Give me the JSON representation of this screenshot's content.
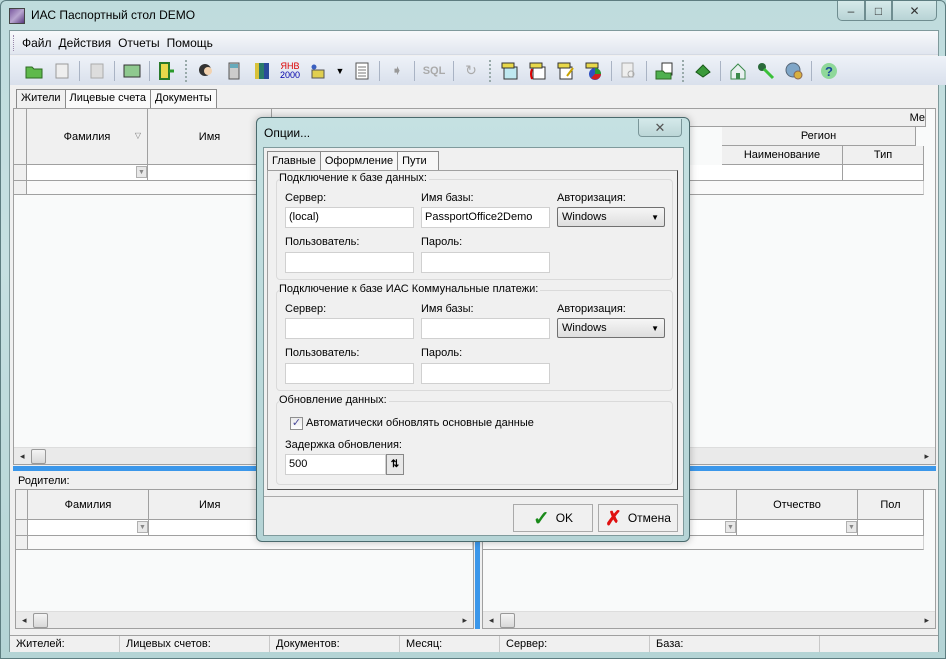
{
  "window": {
    "title": "ИАС Паспортный стол DEMO",
    "controls": {
      "minimize": "–",
      "maximize": "□",
      "close": "✕"
    }
  },
  "menu": [
    "Файл",
    "Действия",
    "Отчеты",
    "Помощь"
  ],
  "toolbar": {
    "icons": [
      "open-folder-icon",
      "document-icon",
      "calculator-icon",
      "image-icon",
      "exit-door-icon",
      "users-icon",
      "phone-icon",
      "books-icon",
      "calendar-icon",
      "package-icon",
      "list-icon",
      "import-icon",
      "sql-icon",
      "redo-icon",
      "print-notes-icon",
      "print-code-icon",
      "print-edit-icon",
      "print-chart-icon",
      "preview-icon",
      "open-file-icon",
      "money-icon",
      "home-icon",
      "key-icon",
      "globe-settings-icon",
      "help-icon"
    ],
    "calendar_top": "ЯНВ",
    "calendar_bottom": "2000",
    "sql_label": "SQL"
  },
  "tabs": [
    "Жители",
    "Лицевые счета",
    "Документы"
  ],
  "residents_grid": {
    "columns": [
      "Фамилия",
      "Имя"
    ],
    "right_group_header": "Ме",
    "region_group": "Регион",
    "region_columns": [
      "Наименование",
      "Тип"
    ]
  },
  "parents": {
    "label": "Родители:",
    "left_columns": [
      "Фамилия",
      "Имя"
    ],
    "right_columns": [
      "Отчество",
      "Пол"
    ]
  },
  "statusbar": [
    "Жителей:",
    "Лицевых счетов:",
    "Документов:",
    "Месяц:",
    "Сервер:",
    "База:"
  ],
  "dialog": {
    "title": "Опции...",
    "close": "✕",
    "tabs": [
      "Главные",
      "Оформление",
      "Пути"
    ],
    "db_group": {
      "label": "Подключение к базе данных:",
      "server_label": "Сервер:",
      "server_value": "(local)",
      "dbname_label": "Имя базы:",
      "dbname_value": "PassportOffice2Demo",
      "auth_label": "Авторизация:",
      "auth_value": "Windows",
      "user_label": "Пользователь:",
      "user_value": "",
      "password_label": "Пароль:",
      "password_value": ""
    },
    "payments_group": {
      "label": "Подключение к базе ИАС Коммунальные платежи:",
      "server_label": "Сервер:",
      "server_value": "",
      "dbname_label": "Имя базы:",
      "dbname_value": "",
      "auth_label": "Авторизация:",
      "auth_value": "Windows",
      "user_label": "Пользователь:",
      "user_value": "",
      "password_label": "Пароль:",
      "password_value": ""
    },
    "update_group": {
      "label": "Обновление данных:",
      "auto_update_label": "Автоматически обновлять основные данные",
      "auto_update_checked": true,
      "delay_label": "Задержка обновления:",
      "delay_value": "500"
    },
    "ok_label": "OK",
    "cancel_label": "Отмена"
  }
}
